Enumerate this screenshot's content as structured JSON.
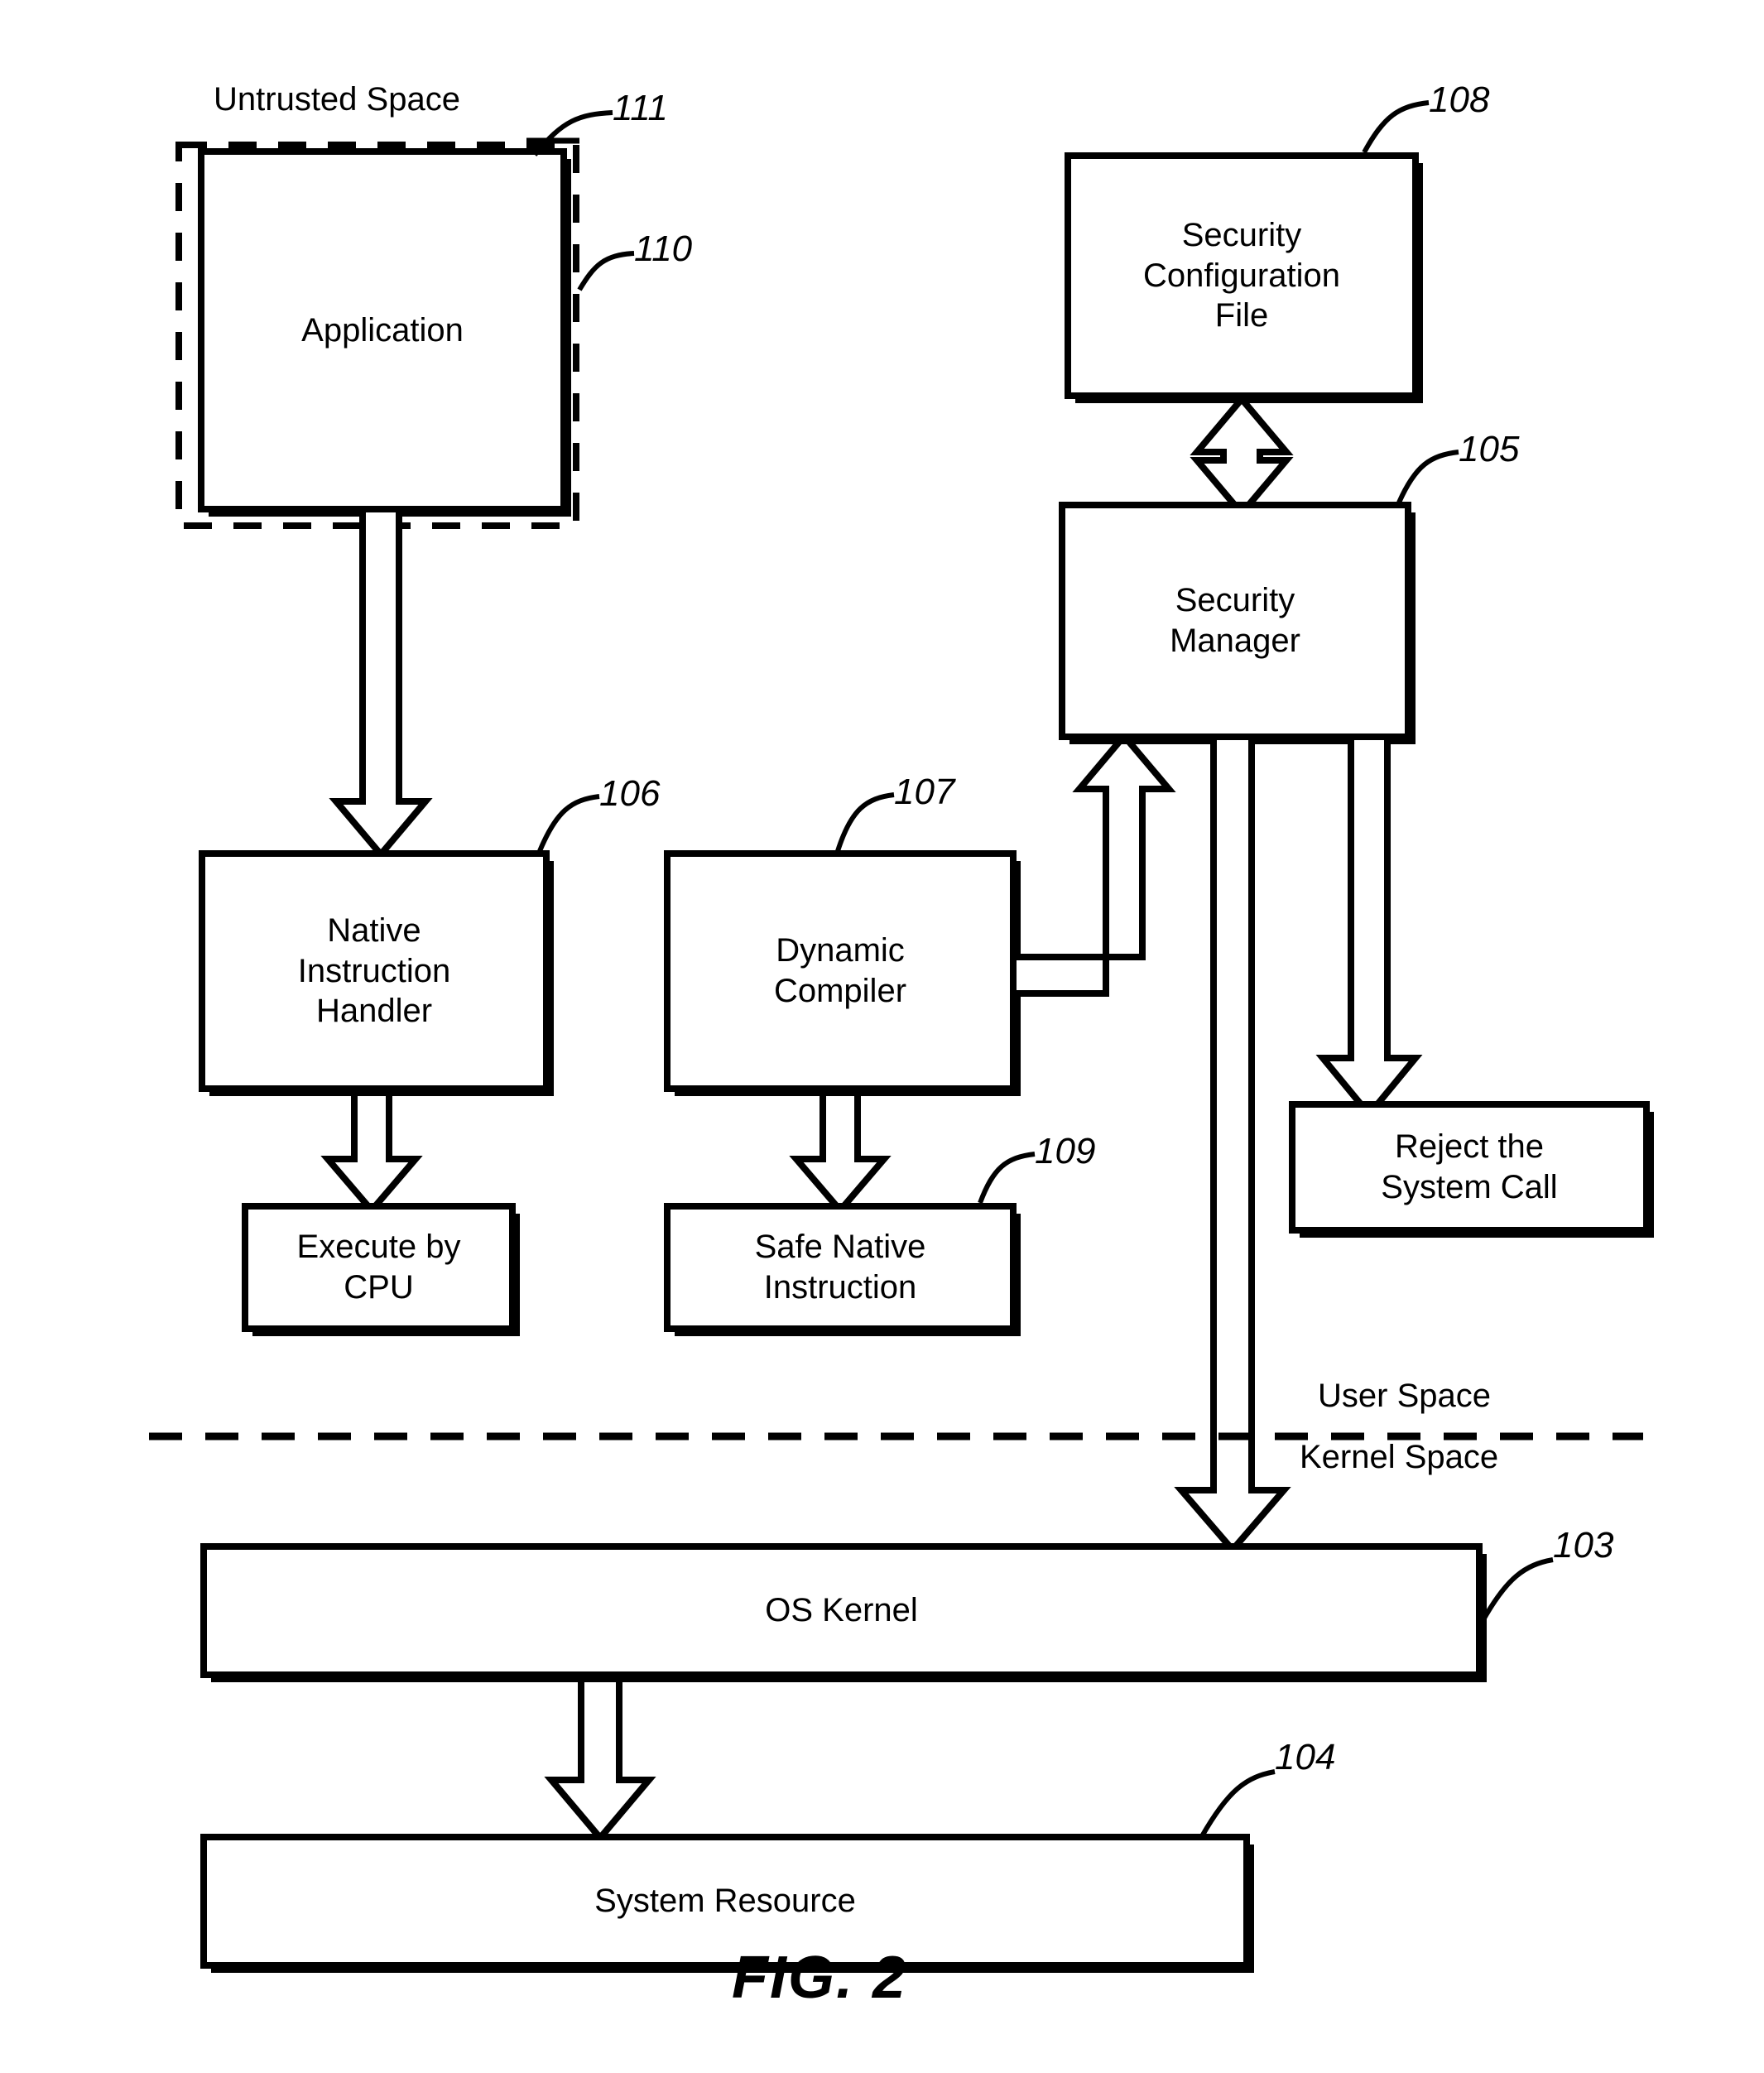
{
  "figure": {
    "caption": "FIG. 2",
    "title": "Untrusted Space",
    "region_labels": {
      "user_space": "User Space",
      "kernel_space": "Kernel Space"
    }
  },
  "boxes": {
    "application": {
      "label": "Application",
      "ref": "110"
    },
    "untrusted_space": {
      "label": "Untrusted Space",
      "ref": "111"
    },
    "native_instruction_handler": {
      "label": "Native\nInstruction\nHandler",
      "ref": "106"
    },
    "execute_by_cpu": {
      "label": "Execute by\nCPU",
      "ref": ""
    },
    "dynamic_compiler": {
      "label": "Dynamic\nCompiler",
      "ref": "107"
    },
    "safe_native_instruction": {
      "label": "Safe Native\nInstruction",
      "ref": "109"
    },
    "security_configuration_file": {
      "label": "Security\nConfiguration\nFile",
      "ref": "108"
    },
    "security_manager": {
      "label": "Security\nManager",
      "ref": "105"
    },
    "reject_system_call": {
      "label": "Reject the\nSystem Call",
      "ref": ""
    },
    "os_kernel": {
      "label": "OS Kernel",
      "ref": "103"
    },
    "system_resource": {
      "label": "System Resource",
      "ref": "104"
    }
  },
  "colors": {
    "stroke": "#000000",
    "fill": "#ffffff",
    "background": "#ffffff"
  }
}
